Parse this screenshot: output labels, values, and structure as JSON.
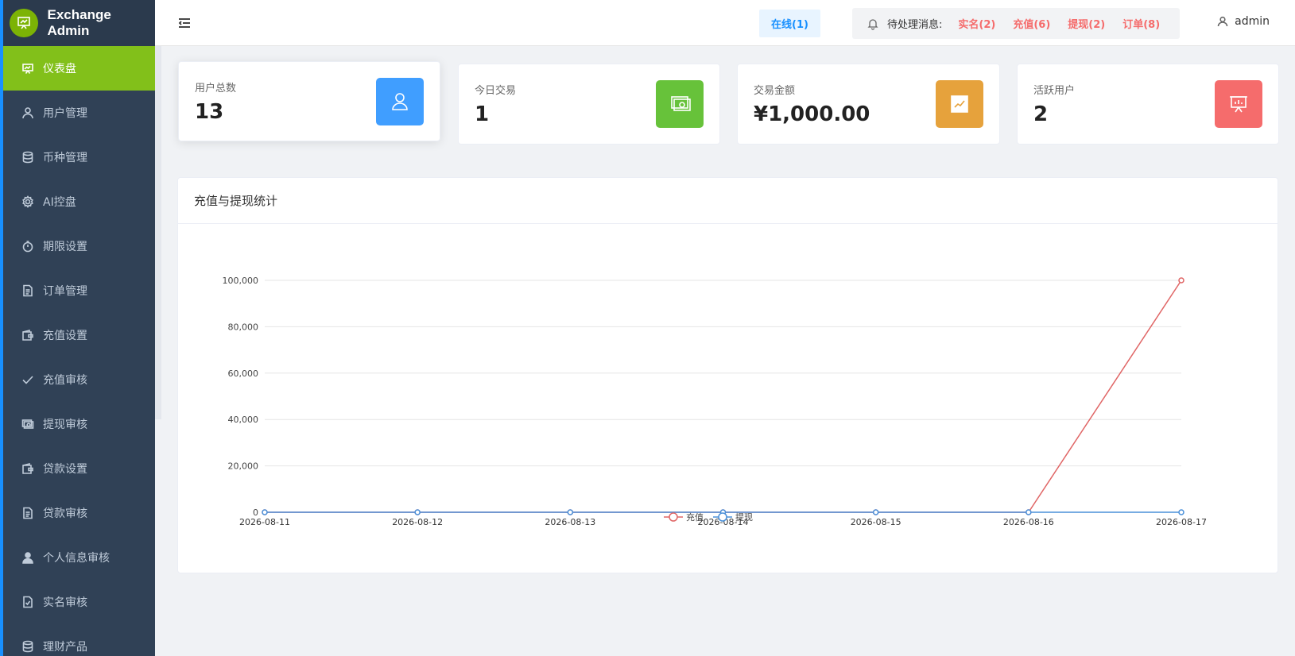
{
  "app": {
    "title": "Exchange Admin"
  },
  "sidebar": {
    "items": [
      {
        "label": "仪表盘",
        "icon": "dashboard-icon",
        "active": true
      },
      {
        "label": "用户管理",
        "icon": "user-icon"
      },
      {
        "label": "币种管理",
        "icon": "database-icon"
      },
      {
        "label": "AI控盘",
        "icon": "gear-icon"
      },
      {
        "label": "期限设置",
        "icon": "timer-icon"
      },
      {
        "label": "订单管理",
        "icon": "document-icon"
      },
      {
        "label": "充值设置",
        "icon": "wallet-icon"
      },
      {
        "label": "充值审核",
        "icon": "check-icon"
      },
      {
        "label": "提现审核",
        "icon": "money-icon"
      },
      {
        "label": "贷款设置",
        "icon": "wallet-icon"
      },
      {
        "label": "贷款审核",
        "icon": "document-icon"
      },
      {
        "label": "个人信息审核",
        "icon": "person-filled-icon"
      },
      {
        "label": "实名审核",
        "icon": "doc-check-icon"
      },
      {
        "label": "理财产品",
        "icon": "database-icon"
      }
    ]
  },
  "header": {
    "online": "在线(1)",
    "pending_label": "待处理消息:",
    "pending": [
      "实名(2)",
      "充值(6)",
      "提现(2)",
      "订单(8)"
    ],
    "user": "admin"
  },
  "stats": [
    {
      "label": "用户总数",
      "value": "13",
      "color": "#409eff",
      "icon": "user-icon"
    },
    {
      "label": "今日交易",
      "value": "1",
      "color": "#67c23a",
      "icon": "money-icon"
    },
    {
      "label": "交易金额",
      "value": "¥1,000.00",
      "color": "#e6a23c",
      "icon": "trend-chart-icon"
    },
    {
      "label": "活跃用户",
      "value": "2",
      "color": "#f56c6c",
      "icon": "presentation-icon"
    }
  ],
  "chart_card": {
    "title": "充值与提现统计"
  },
  "chart_data": {
    "type": "line",
    "x": [
      "2026-08-11",
      "2026-08-12",
      "2026-08-13",
      "2026-08-14",
      "2026-08-15",
      "2026-08-16",
      "2026-08-17"
    ],
    "ylim": [
      0,
      100000
    ],
    "yticks": [
      "0",
      "20,000",
      "40,000",
      "60,000",
      "80,000",
      "100,000"
    ],
    "yticks_values": [
      0,
      20000,
      40000,
      60000,
      80000,
      100000
    ],
    "grid": true,
    "legend": "bottom-center",
    "series": [
      {
        "name": "充值",
        "color": "#e06666",
        "values": [
          0,
          0,
          0,
          0,
          0,
          0,
          100000
        ]
      },
      {
        "name": "提现",
        "color": "#4a90d9",
        "values": [
          0,
          0,
          0,
          0,
          0,
          0,
          0
        ]
      }
    ]
  }
}
